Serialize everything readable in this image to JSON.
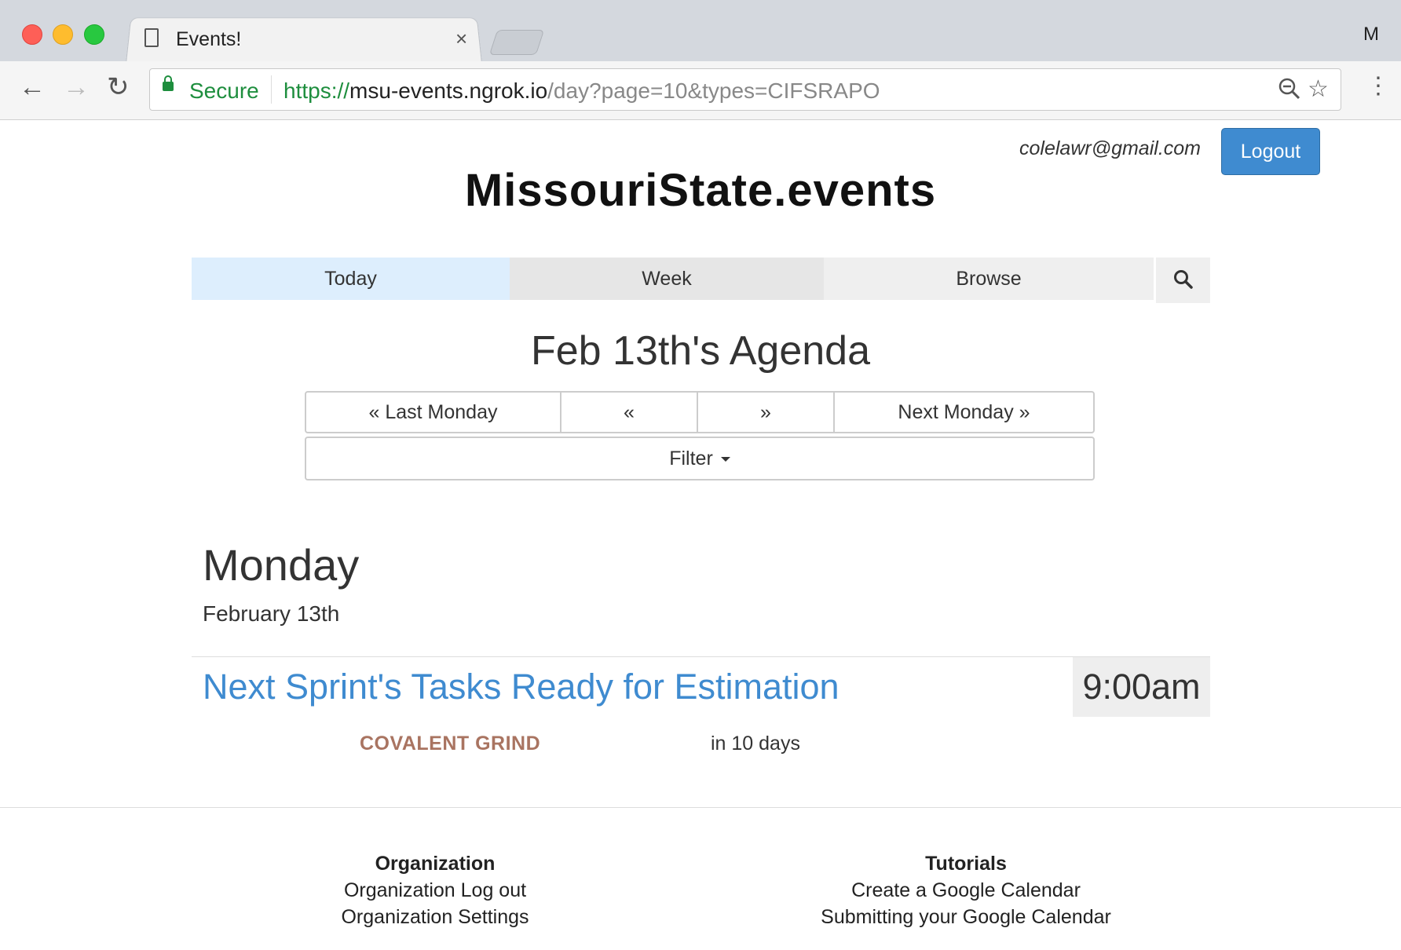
{
  "browser": {
    "tab_title": "Events!",
    "tab_close": "×",
    "profile_initial": "M",
    "secure_label": "Secure",
    "url_scheme": "https://",
    "url_host": "msu-events.ngrok.io",
    "url_path": "/day?page=10&types=CIFSRAPO"
  },
  "header": {
    "user_email": "colelawr@gmail.com",
    "logout_label": "Logout",
    "logo_text": "MissouriState.events"
  },
  "nav": {
    "today": "Today",
    "week": "Week",
    "browse": "Browse"
  },
  "agenda": {
    "title": "Feb 13th's Agenda",
    "last_monday": "« Last Monday",
    "prev": "«",
    "next": "»",
    "next_monday": "Next Monday »",
    "filter": "Filter"
  },
  "day": {
    "name": "Monday",
    "date": "February 13th"
  },
  "event": {
    "title": "Next Sprint's Tasks Ready for Estimation",
    "time": "9:00am",
    "organization": "COVALENT GRIND",
    "relative": "in 10 days"
  },
  "footer": {
    "organization": {
      "heading": "Organization",
      "links": [
        "Organization Log out",
        "Organization Settings"
      ]
    },
    "tutorials": {
      "heading": "Tutorials",
      "links": [
        "Create a Google Calendar",
        "Submitting your Google Calendar"
      ]
    }
  },
  "colors": {
    "accent": "#3f8bd0",
    "org_label": "#a97461",
    "today_tab": "#ddeefd"
  }
}
